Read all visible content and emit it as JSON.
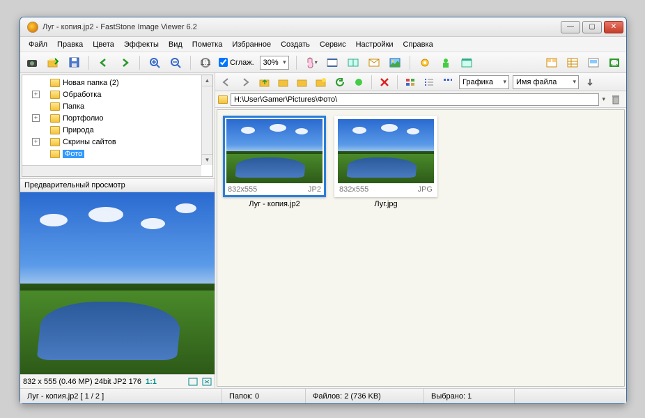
{
  "window": {
    "title": "Луг - копия.jp2  -  FastStone Image Viewer 6.2"
  },
  "menu": [
    "Файл",
    "Правка",
    "Цвета",
    "Эффекты",
    "Вид",
    "Пометка",
    "Избранное",
    "Создать",
    "Сервис",
    "Настройки",
    "Справка"
  ],
  "toolbar1": {
    "smooth_label": "Сглаж.",
    "zoom_value": "30%"
  },
  "tree": {
    "items": [
      {
        "label": "Новая папка (2)",
        "expand": ""
      },
      {
        "label": "Обработка",
        "expand": "+"
      },
      {
        "label": "Папка",
        "expand": ""
      },
      {
        "label": "Портфолио",
        "expand": "+"
      },
      {
        "label": "Природа",
        "expand": ""
      },
      {
        "label": "Скрины сайтов",
        "expand": "+"
      },
      {
        "label": "Фото",
        "expand": "",
        "selected": true
      }
    ]
  },
  "preview": {
    "header": "Предварительный просмотр",
    "status": "832 x 555 (0.46 MP)  24bit  JP2   176",
    "ratio": "1:1"
  },
  "toolbar2": {
    "sort1": "Графика",
    "sort2": "Имя файла"
  },
  "path": "H:\\User\\Gamer\\Pictures\\Фото\\",
  "thumbs": [
    {
      "dims": "832x555",
      "fmt": "JP2",
      "name": "Луг - копия.jp2",
      "selected": true
    },
    {
      "dims": "832x555",
      "fmt": "JPG",
      "name": "Луг.jpg",
      "selected": false
    }
  ],
  "status": {
    "file": "Луг - копия.jp2 [ 1 / 2 ]",
    "folders": "Папок: 0",
    "files": "Файлов: 2 (736 KB)",
    "selected": "Выбрано: 1"
  }
}
